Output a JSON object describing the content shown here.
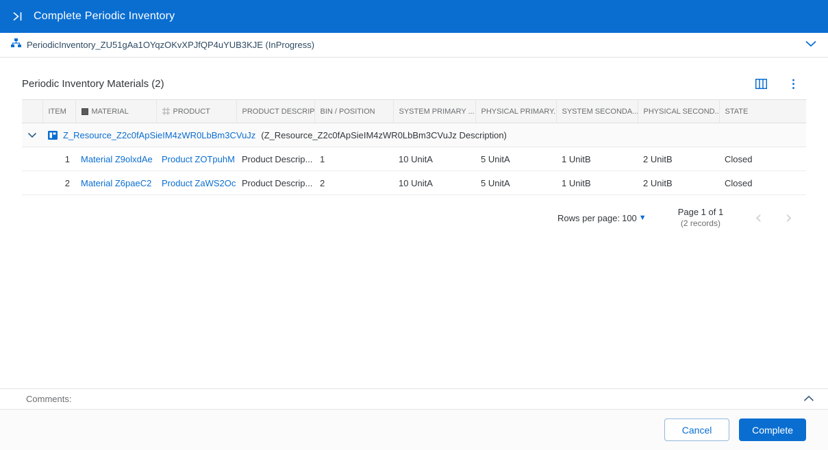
{
  "colors": {
    "accent": "#0a6ed1",
    "header_bg": "#0a6ed1",
    "link": "#0a6ed1",
    "table_header_bg": "#f5f5f5"
  },
  "header": {
    "title": "Complete Periodic Inventory"
  },
  "order": {
    "label": "PeriodicInventory_ZU51gAa1OYqzOKvXPJfQP4uYUB3KJE (InProgress)"
  },
  "section": {
    "title": "Periodic Inventory Materials (2)"
  },
  "table": {
    "columns": {
      "item": "ITEM",
      "material": "MATERIAL",
      "product": "PRODUCT",
      "product_description": "PRODUCT DESCRIP...",
      "bin_position": "BIN / POSITION",
      "system_primary": "SYSTEM PRIMARY ...",
      "physical_primary": "PHYSICAL PRIMARY...",
      "system_secondary": "SYSTEM SECONDA...",
      "physical_secondary": "PHYSICAL SECOND...",
      "state": "STATE"
    },
    "group": {
      "link": "Z_Resource_Z2c0fApSieIM4zWR0LbBm3CVuJz",
      "description": "(Z_Resource_Z2c0fApSieIM4zWR0LbBm3CVuJz Description)"
    },
    "rows": [
      {
        "item": "1",
        "material": "Material Z9olxdAe",
        "product": "Product ZOTpuhM",
        "product_description": "Product Descrip...",
        "bin_position": "1",
        "system_primary": "10 UnitA",
        "physical_primary": "5 UnitA",
        "system_secondary": "1 UnitB",
        "physical_secondary": "2 UnitB",
        "state": "Closed"
      },
      {
        "item": "2",
        "material": "Material Z6paeC2",
        "product": "Product ZaWS2Oc",
        "product_description": "Product Descrip...",
        "bin_position": "2",
        "system_primary": "10 UnitA",
        "physical_primary": "5 UnitA",
        "system_secondary": "1 UnitB",
        "physical_secondary": "2 UnitB",
        "state": "Closed"
      }
    ]
  },
  "pagination": {
    "rows_per_page_label": "Rows per page:",
    "rows_per_page_value": "100",
    "page_label": "Page 1 of 1",
    "records_label": "(2 records)"
  },
  "comments": {
    "label": "Comments:"
  },
  "footer": {
    "cancel_label": "Cancel",
    "complete_label": "Complete"
  },
  "icons": {
    "kebab": "⋮",
    "caret_down": "▼",
    "prev": "‹",
    "next": "›"
  }
}
